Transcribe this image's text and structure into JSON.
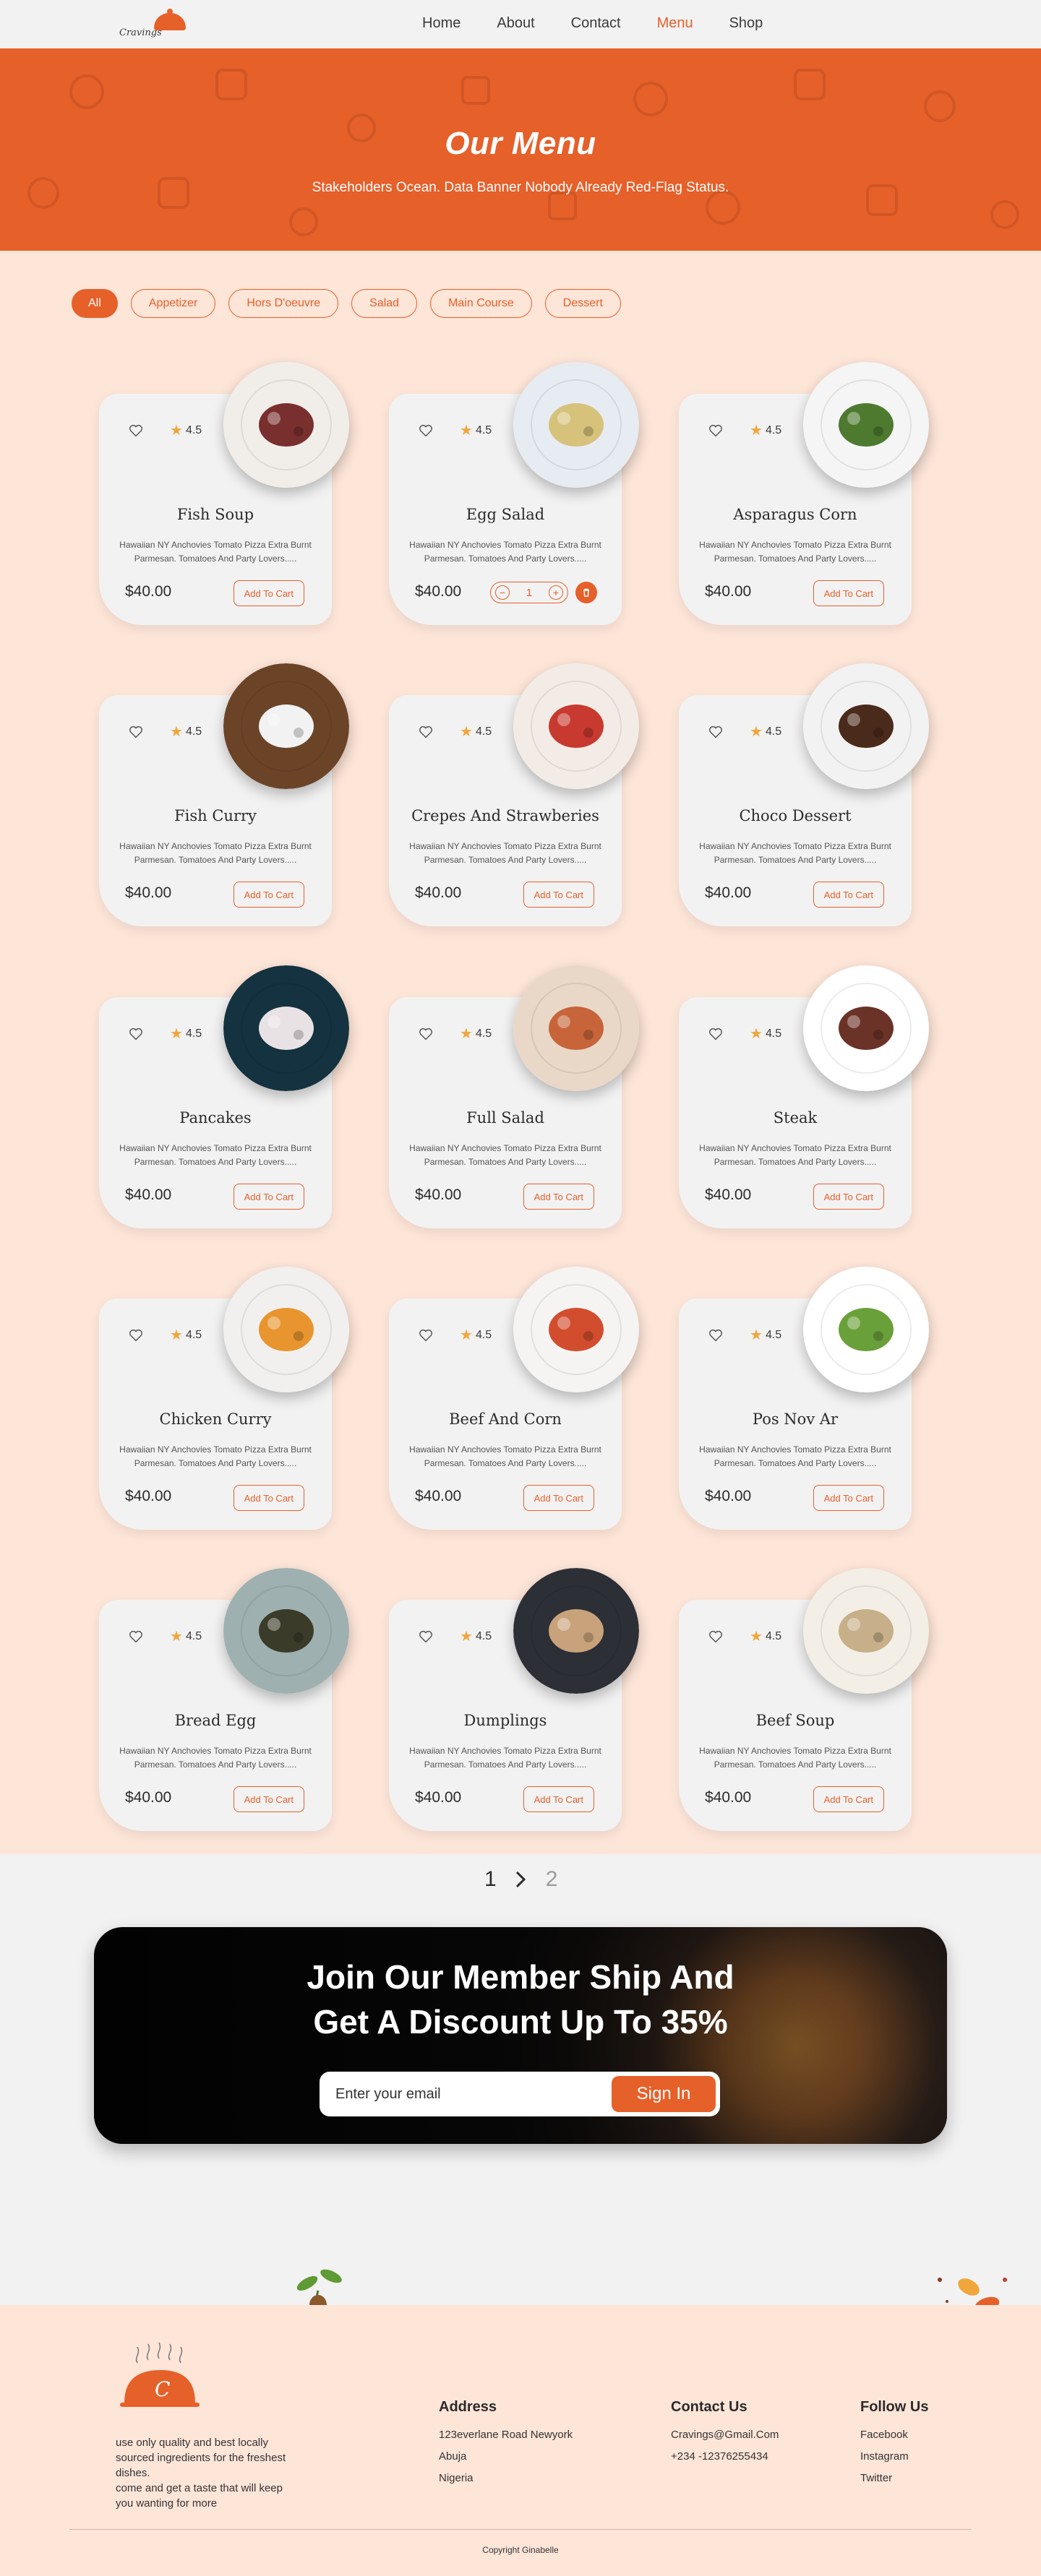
{
  "header": {
    "logo_text": "Cravings",
    "nav": [
      {
        "label": "Home"
      },
      {
        "label": "About"
      },
      {
        "label": "Contact"
      },
      {
        "label": "Menu",
        "active": true
      },
      {
        "label": "Shop"
      }
    ]
  },
  "hero": {
    "title": "Our Menu",
    "subtitle": "Stakeholders Ocean. Data Banner Nobody Already Red-Flag Status."
  },
  "filters": [
    "All",
    "Appetizer",
    "Hors D'oeuvre",
    "Salad",
    "Main Course",
    "Dessert"
  ],
  "active_filter": "All",
  "menu": {
    "description": "Hawaiian NY Anchovies Tomato Pizza Extra Burnt Parmesan. Tomatoes And Party Lovers.....",
    "cart_label": "Add To Cart",
    "items": [
      {
        "name": "Fish Soup",
        "rating": "4.5",
        "price": "$40.00",
        "plate": "#f1eee9",
        "food": "#7a2f2f"
      },
      {
        "name": "Egg Salad",
        "rating": "4.5",
        "price": "$40.00",
        "plate": "#e7ebf2",
        "food": "#d6c27a",
        "quantity": "1"
      },
      {
        "name": "Asparagus Corn",
        "rating": "4.5",
        "price": "$40.00",
        "plate": "#f5f5f5",
        "food": "#4d7a2f"
      },
      {
        "name": "Fish Curry",
        "rating": "4.5",
        "price": "$40.00",
        "plate": "#6b4428",
        "food": "#f2f2f2"
      },
      {
        "name": "Crepes And Strawberies",
        "rating": "4.5",
        "price": "$40.00",
        "plate": "#f3ece6",
        "food": "#c8392f"
      },
      {
        "name": "Choco Dessert",
        "rating": "4.5",
        "price": "$40.00",
        "plate": "#f3f2f2",
        "food": "#4a2a1a"
      },
      {
        "name": "Pancakes",
        "rating": "4.5",
        "price": "$40.00",
        "plate": "#14323f",
        "food": "#e9e2e4"
      },
      {
        "name": "Full Salad",
        "rating": "4.5",
        "price": "$40.00",
        "plate": "#e9d8c8",
        "food": "#c7643a"
      },
      {
        "name": "Steak",
        "rating": "4.5",
        "price": "$40.00",
        "plate": "#ffffff",
        "food": "#6b3327"
      },
      {
        "name": "Chicken Curry",
        "rating": "4.5",
        "price": "$40.00",
        "plate": "#f2f0ee",
        "food": "#e8952f"
      },
      {
        "name": "Beef And Corn",
        "rating": "4.5",
        "price": "$40.00",
        "plate": "#f6f4f2",
        "food": "#d24d2e"
      },
      {
        "name": "Pos Nov Ar",
        "rating": "4.5",
        "price": "$40.00",
        "plate": "#ffffff",
        "food": "#6aa03a"
      },
      {
        "name": "Bread Egg",
        "rating": "4.5",
        "price": "$40.00",
        "plate": "#9eb0b0",
        "food": "#3b3b2a"
      },
      {
        "name": "Dumplings",
        "rating": "4.5",
        "price": "$40.00",
        "plate": "#2d2f36",
        "food": "#c8a27a"
      },
      {
        "name": "Beef Soup",
        "rating": "4.5",
        "price": "$40.00",
        "plate": "#f3efe6",
        "food": "#c7b089"
      }
    ]
  },
  "pagination": {
    "current": "1",
    "next": "2"
  },
  "newsletter": {
    "line1": "Join Our Member Ship And",
    "line2": "Get A Discount Up To 35%",
    "placeholder": "Enter your email",
    "button": "Sign In"
  },
  "footer": {
    "about_lines": [
      "use only quality and best locally",
      "sourced ingredients for the freshest",
      "dishes.",
      "come and get a taste that will keep",
      "you wanting for more"
    ],
    "address": {
      "heading": "Address",
      "lines": [
        "123everlane Road Newyork",
        "Abuja",
        "Nigeria"
      ]
    },
    "contact": {
      "heading": "Contact Us",
      "lines": [
        "Cravings@Gmail.Com",
        "+234 -12376255434"
      ]
    },
    "follow": {
      "heading": "Follow Us",
      "lines": [
        "Facebook",
        "Instagram",
        "Twitter"
      ]
    },
    "copyright": "Copyright Ginabelle"
  },
  "colors": {
    "accent": "#e6602a",
    "page_bg": "#fde5d8",
    "card_bg": "#f3f2f2",
    "star": "#f0a63a"
  },
  "icons": [
    "heart-icon",
    "star-icon",
    "chevron-right-icon",
    "trash-icon",
    "cloche-icon"
  ]
}
